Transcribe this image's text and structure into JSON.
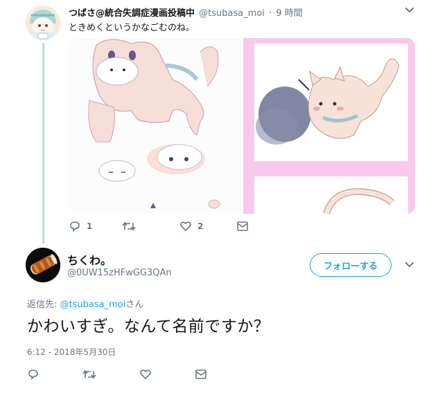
{
  "original_tweet": {
    "display_name": "つばさ@統合失調症漫画投稿中",
    "handle": "@tsubasa_moi",
    "time_separator": "·",
    "time": "9 時間",
    "text": "ときめくというかなごむのね。",
    "actions": {
      "reply_count": "1",
      "retweet_count": "",
      "like_count": "2"
    }
  },
  "reply_tweet": {
    "display_name": "ちくわ。",
    "handle": "@0UW15zHFwGG3QAn",
    "follow_label": "フォローする",
    "replying_to_prefix": "返信先: ",
    "replying_to_handle": "@tsubasa_moi",
    "replying_to_suffix": "さん",
    "text": "かわいすぎ。なんて名前ですか？",
    "timestamp": "6:12 - 2018年5月30日"
  },
  "colors": {
    "accent": "#1da1f2",
    "thread_line": "#b9dcf0",
    "muted": "#657786",
    "media_pink_frame": "#f9c9ec"
  },
  "icons": [
    "chevron-down-icon",
    "reply-icon",
    "retweet-icon",
    "like-icon",
    "message-icon"
  ]
}
